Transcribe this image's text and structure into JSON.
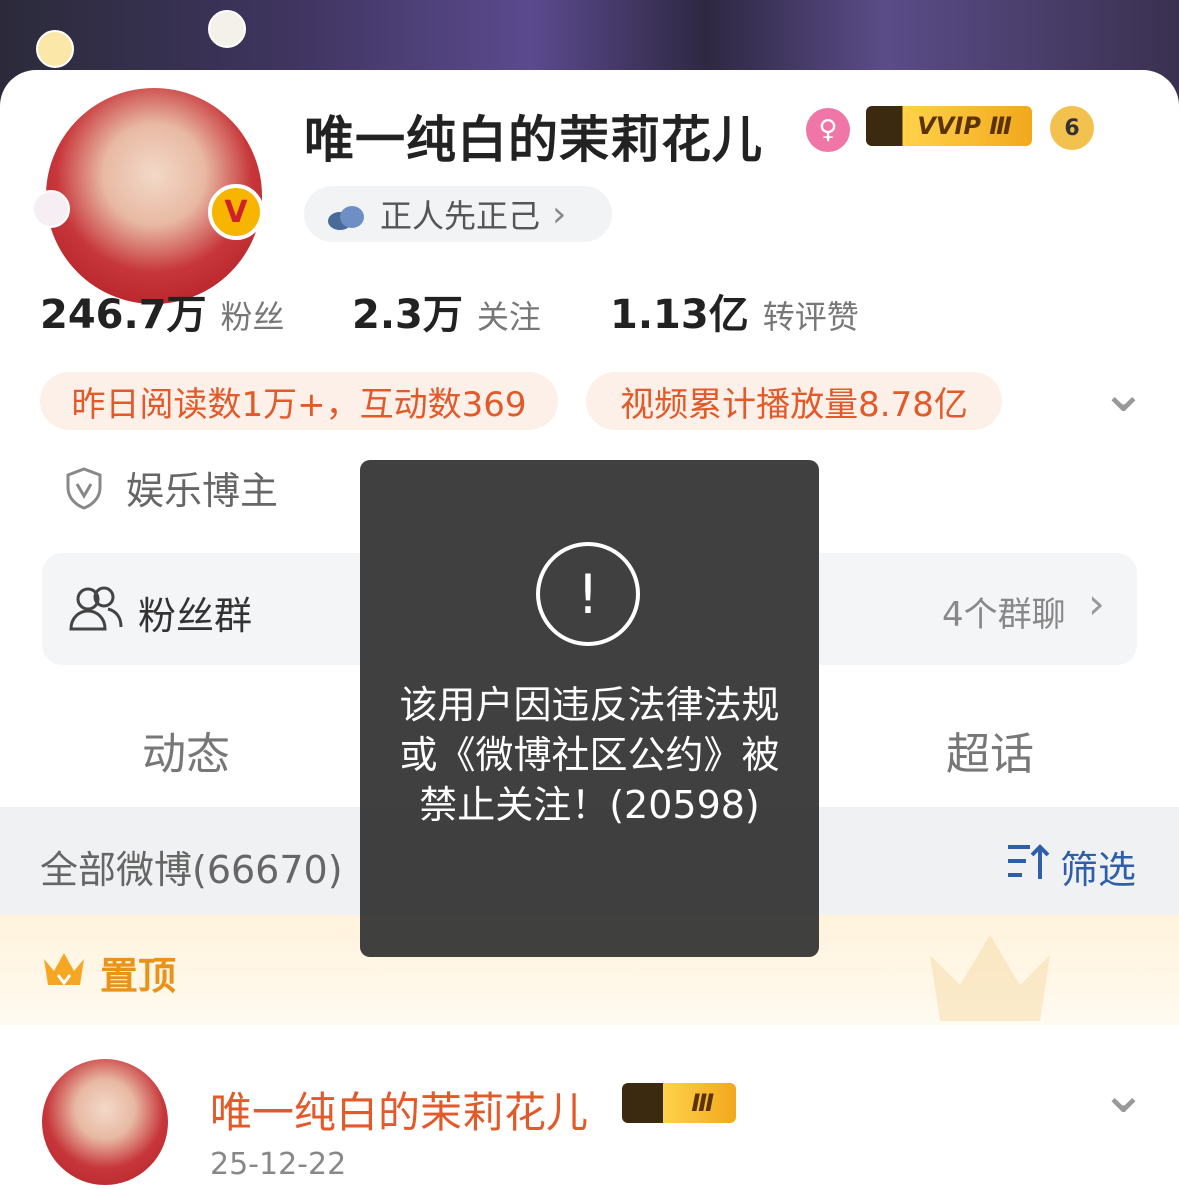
{
  "profile": {
    "name": "唯一纯白的茉莉花儿",
    "gender_glyph": "♀",
    "vvip_label": "VVIP Ⅲ",
    "level_glyph": "6",
    "verified_glyph": "V",
    "ip_text": "正人先正己",
    "ip_chevron": "›"
  },
  "stats": [
    {
      "value": "246.7万",
      "label": "粉丝"
    },
    {
      "value": "2.3万",
      "label": "关注"
    },
    {
      "value": "1.13亿",
      "label": "转评赞"
    }
  ],
  "pills": [
    {
      "text": "昨日阅读数1万+，互动数369"
    },
    {
      "text": "视频累计播放量8.78亿"
    }
  ],
  "expand_glyph": "⌄",
  "role": {
    "icon_glyph": "V",
    "text": "娱乐博主"
  },
  "fan_group": {
    "label": "粉丝群",
    "count": "4个群聊",
    "chevron": "›"
  },
  "tabs": [
    {
      "label": "动态"
    },
    {
      "label": "超话"
    }
  ],
  "filter": {
    "all_label": "全部微博(66670)",
    "filter_label": "筛选"
  },
  "pinned": {
    "label": "置顶"
  },
  "post": {
    "author": "唯一纯白的茉莉花儿",
    "vip_badge": "Ⅲ",
    "date": "25-12-22",
    "menu_glyph": "⌄"
  },
  "toast": {
    "icon_glyph": "!",
    "message": "该用户因违反法律法规或《微博社区公约》被禁止关注！(20598)"
  },
  "colors": {
    "accent_orange": "#e25a2a",
    "pill_bg": "#fdf0e8",
    "filter_blue": "#2f5fa8",
    "toast_bg": "#323232"
  }
}
